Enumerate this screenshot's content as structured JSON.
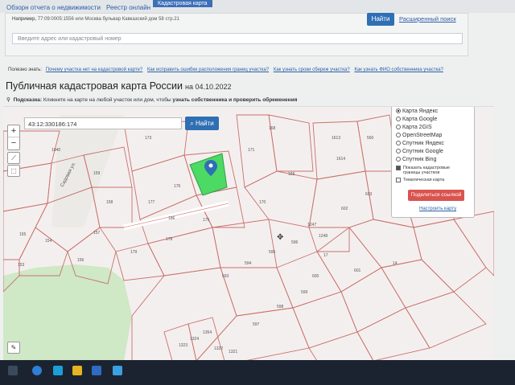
{
  "topnav": {
    "items": [
      "Обзорн отчета о недвижимости",
      "Реестр онлайн",
      "Кадастровая карта"
    ]
  },
  "search": {
    "example_prefix": "Например,",
    "example_text": "77:09:0005:1556 или Москва бульвар Кавказский дом 58 стр.21",
    "placeholder": "Введите адрес или кадастровый номер",
    "find_label": "Найти",
    "advanced_label": "Расширенный поиск"
  },
  "useful": {
    "prefix": "Полезно знать:",
    "links": [
      "Почему участка нет на кадастровой карте?",
      "Как исправить ошибки расположения границ участка?",
      "Как узнать сроки сбереж участка?",
      "Как узнать ФИО собственника участка?"
    ]
  },
  "page": {
    "title": "Публичная кадастровая карта России",
    "date": "на 04.10.2022",
    "hint_label": "Подсказка:",
    "hint_text": "Кликните на карте на любой участок или дом, чтобы",
    "hint_bold": "узнать собственника и проверить обременения"
  },
  "map": {
    "coord_value": "43:12:330186:174",
    "find_label": "Найти",
    "zoom_in": "+",
    "zoom_out": "−",
    "street_label": "Садовая ул.",
    "parcel_labels": [
      "1040",
      "1041",
      "173",
      "168",
      "171",
      "169",
      "159",
      "176",
      "170",
      "158",
      "177",
      "175",
      "157",
      "155",
      "154",
      "156",
      "153",
      "178",
      "179",
      "186",
      "594",
      "593",
      "595",
      "596",
      "597",
      "598",
      "599",
      "600",
      "601",
      "602",
      "603",
      "1613",
      "1614",
      "560",
      "1247",
      "1248",
      "17",
      "14",
      "1354",
      "1324",
      "1323",
      "1322",
      "1321"
    ],
    "highlight_color": "#4cd964",
    "parcel_line_color": "#c9706a",
    "forest_color": "#cfe8c6"
  },
  "layers": {
    "options": [
      "Карта Яндекс",
      "Карта Google",
      "Карта 2GIS",
      "OpenStreetMap",
      "Спутник Яндекс",
      "Спутник Google",
      "Спутник Bing"
    ],
    "selected_index": 0,
    "checkbox_boundaries": "Показать кадастровые границы участков",
    "checkbox_thematic": "Тематическая карта",
    "share_label": "Поделиться ссылкой",
    "config_label": "Настроить карту"
  }
}
